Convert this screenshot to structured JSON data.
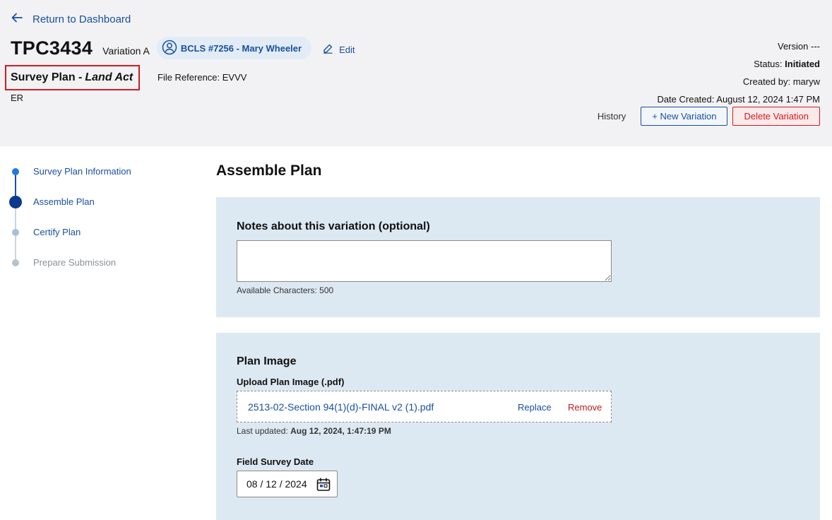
{
  "nav": {
    "back_label": "Return to Dashboard"
  },
  "project": {
    "id": "TPC3434",
    "variation": "Variation A",
    "surveyor": "BCLS #7256 - Mary Wheeler",
    "edit_label": "Edit",
    "plan_type": "Survey Plan -",
    "plan_act": "Land Act",
    "file_reference": "File Reference: EVVV",
    "region": "ER"
  },
  "meta": {
    "version_label": "Version",
    "version_value": "---",
    "status_label": "Status:",
    "status_value": "Initiated",
    "created_by_label": "Created by:",
    "created_by_value": "maryw",
    "date_created_label": "Date Created:",
    "date_created_value": "August 12, 2024 1:47 PM"
  },
  "actions": {
    "history": "History",
    "new_variation": "+ New Variation",
    "delete_variation": "Delete Variation"
  },
  "steps": [
    {
      "label": "Survey Plan Information",
      "state": "completed"
    },
    {
      "label": "Assemble Plan",
      "state": "current"
    },
    {
      "label": "Certify Plan",
      "state": "upcoming"
    },
    {
      "label": "Prepare Submission",
      "state": "disabled"
    }
  ],
  "main": {
    "title": "Assemble Plan",
    "notes": {
      "label": "Notes about this variation (optional)",
      "value": "",
      "available_chars": "Available Characters: 500"
    },
    "plan_image": {
      "section_title": "Plan Image",
      "upload_label": "Upload Plan Image (.pdf)",
      "file_name": "2513-02-Section 94(1)(d)-FINAL v2 (1).pdf",
      "replace_label": "Replace",
      "remove_label": "Remove",
      "last_updated_label": "Last updated:",
      "last_updated_value": "Aug 12, 2024, 1:47:19 PM"
    },
    "survey_date": {
      "label": "Field Survey Date",
      "value": "08 / 12 / 2024"
    }
  },
  "colors": {
    "accent": "#1a4fa0",
    "danger": "#d71920",
    "panel": "#dde9f2",
    "header": "#f2f2f4"
  }
}
